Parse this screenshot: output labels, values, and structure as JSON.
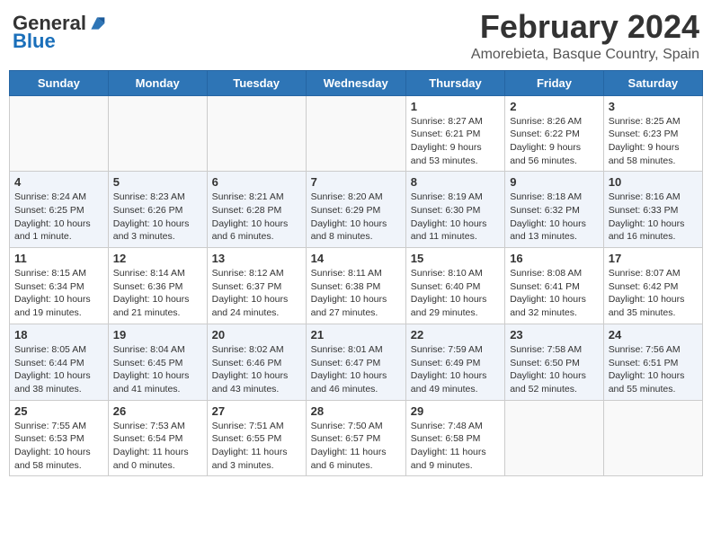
{
  "header": {
    "logo_general": "General",
    "logo_blue": "Blue",
    "month_title": "February 2024",
    "location": "Amorebieta, Basque Country, Spain"
  },
  "days_of_week": [
    "Sunday",
    "Monday",
    "Tuesday",
    "Wednesday",
    "Thursday",
    "Friday",
    "Saturday"
  ],
  "weeks": [
    {
      "stripe": false,
      "days": [
        {
          "num": "",
          "info": ""
        },
        {
          "num": "",
          "info": ""
        },
        {
          "num": "",
          "info": ""
        },
        {
          "num": "",
          "info": ""
        },
        {
          "num": "1",
          "info": "Sunrise: 8:27 AM\nSunset: 6:21 PM\nDaylight: 9 hours\nand 53 minutes."
        },
        {
          "num": "2",
          "info": "Sunrise: 8:26 AM\nSunset: 6:22 PM\nDaylight: 9 hours\nand 56 minutes."
        },
        {
          "num": "3",
          "info": "Sunrise: 8:25 AM\nSunset: 6:23 PM\nDaylight: 9 hours\nand 58 minutes."
        }
      ]
    },
    {
      "stripe": true,
      "days": [
        {
          "num": "4",
          "info": "Sunrise: 8:24 AM\nSunset: 6:25 PM\nDaylight: 10 hours\nand 1 minute."
        },
        {
          "num": "5",
          "info": "Sunrise: 8:23 AM\nSunset: 6:26 PM\nDaylight: 10 hours\nand 3 minutes."
        },
        {
          "num": "6",
          "info": "Sunrise: 8:21 AM\nSunset: 6:28 PM\nDaylight: 10 hours\nand 6 minutes."
        },
        {
          "num": "7",
          "info": "Sunrise: 8:20 AM\nSunset: 6:29 PM\nDaylight: 10 hours\nand 8 minutes."
        },
        {
          "num": "8",
          "info": "Sunrise: 8:19 AM\nSunset: 6:30 PM\nDaylight: 10 hours\nand 11 minutes."
        },
        {
          "num": "9",
          "info": "Sunrise: 8:18 AM\nSunset: 6:32 PM\nDaylight: 10 hours\nand 13 minutes."
        },
        {
          "num": "10",
          "info": "Sunrise: 8:16 AM\nSunset: 6:33 PM\nDaylight: 10 hours\nand 16 minutes."
        }
      ]
    },
    {
      "stripe": false,
      "days": [
        {
          "num": "11",
          "info": "Sunrise: 8:15 AM\nSunset: 6:34 PM\nDaylight: 10 hours\nand 19 minutes."
        },
        {
          "num": "12",
          "info": "Sunrise: 8:14 AM\nSunset: 6:36 PM\nDaylight: 10 hours\nand 21 minutes."
        },
        {
          "num": "13",
          "info": "Sunrise: 8:12 AM\nSunset: 6:37 PM\nDaylight: 10 hours\nand 24 minutes."
        },
        {
          "num": "14",
          "info": "Sunrise: 8:11 AM\nSunset: 6:38 PM\nDaylight: 10 hours\nand 27 minutes."
        },
        {
          "num": "15",
          "info": "Sunrise: 8:10 AM\nSunset: 6:40 PM\nDaylight: 10 hours\nand 29 minutes."
        },
        {
          "num": "16",
          "info": "Sunrise: 8:08 AM\nSunset: 6:41 PM\nDaylight: 10 hours\nand 32 minutes."
        },
        {
          "num": "17",
          "info": "Sunrise: 8:07 AM\nSunset: 6:42 PM\nDaylight: 10 hours\nand 35 minutes."
        }
      ]
    },
    {
      "stripe": true,
      "days": [
        {
          "num": "18",
          "info": "Sunrise: 8:05 AM\nSunset: 6:44 PM\nDaylight: 10 hours\nand 38 minutes."
        },
        {
          "num": "19",
          "info": "Sunrise: 8:04 AM\nSunset: 6:45 PM\nDaylight: 10 hours\nand 41 minutes."
        },
        {
          "num": "20",
          "info": "Sunrise: 8:02 AM\nSunset: 6:46 PM\nDaylight: 10 hours\nand 43 minutes."
        },
        {
          "num": "21",
          "info": "Sunrise: 8:01 AM\nSunset: 6:47 PM\nDaylight: 10 hours\nand 46 minutes."
        },
        {
          "num": "22",
          "info": "Sunrise: 7:59 AM\nSunset: 6:49 PM\nDaylight: 10 hours\nand 49 minutes."
        },
        {
          "num": "23",
          "info": "Sunrise: 7:58 AM\nSunset: 6:50 PM\nDaylight: 10 hours\nand 52 minutes."
        },
        {
          "num": "24",
          "info": "Sunrise: 7:56 AM\nSunset: 6:51 PM\nDaylight: 10 hours\nand 55 minutes."
        }
      ]
    },
    {
      "stripe": false,
      "days": [
        {
          "num": "25",
          "info": "Sunrise: 7:55 AM\nSunset: 6:53 PM\nDaylight: 10 hours\nand 58 minutes."
        },
        {
          "num": "26",
          "info": "Sunrise: 7:53 AM\nSunset: 6:54 PM\nDaylight: 11 hours\nand 0 minutes."
        },
        {
          "num": "27",
          "info": "Sunrise: 7:51 AM\nSunset: 6:55 PM\nDaylight: 11 hours\nand 3 minutes."
        },
        {
          "num": "28",
          "info": "Sunrise: 7:50 AM\nSunset: 6:57 PM\nDaylight: 11 hours\nand 6 minutes."
        },
        {
          "num": "29",
          "info": "Sunrise: 7:48 AM\nSunset: 6:58 PM\nDaylight: 11 hours\nand 9 minutes."
        },
        {
          "num": "",
          "info": ""
        },
        {
          "num": "",
          "info": ""
        }
      ]
    }
  ]
}
